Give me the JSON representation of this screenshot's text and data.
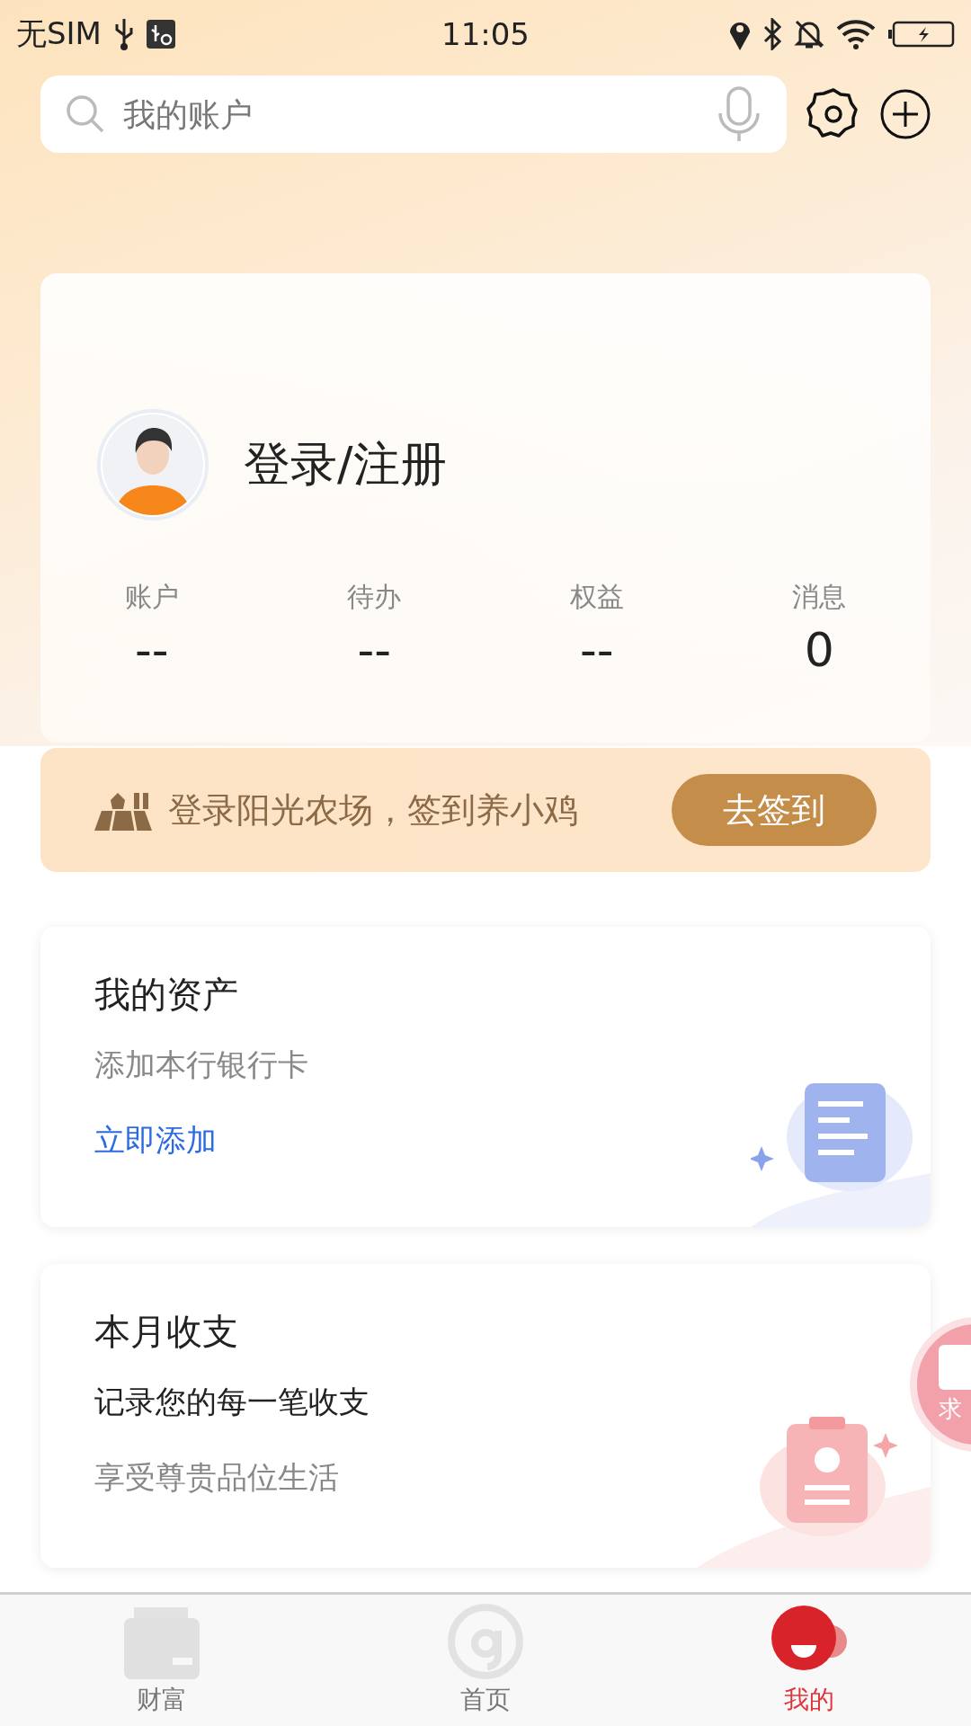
{
  "status_bar": {
    "carrier": "无SIM",
    "time": "11:05"
  },
  "search": {
    "placeholder": "我的账户"
  },
  "profile": {
    "login": "登录/注册",
    "stats": [
      {
        "label": "账户",
        "value": "--"
      },
      {
        "label": "待办",
        "value": "--"
      },
      {
        "label": "权益",
        "value": "--"
      },
      {
        "label": "消息",
        "value": "0"
      }
    ]
  },
  "banner": {
    "text": "登录阳光农场，签到养小鸡",
    "button": "去签到"
  },
  "cards": [
    {
      "kind": "assets",
      "title": "我的资产",
      "lines": [
        {
          "text": "添加本行银行卡",
          "kind": "muted"
        },
        {
          "text": "立即添加",
          "kind": "link"
        }
      ]
    },
    {
      "kind": "budget",
      "title": "本月收支",
      "lines": [
        {
          "text": "记录您的每一笔收支",
          "kind": "dark"
        },
        {
          "text": "享受尊贵品位生活",
          "kind": "muted"
        }
      ]
    }
  ],
  "floating_button": {
    "text": "求"
  },
  "tabs": [
    {
      "label": "财富",
      "kind": "wealth",
      "selected": false
    },
    {
      "label": "首页",
      "kind": "home",
      "selected": false
    },
    {
      "label": "我的",
      "kind": "mine",
      "selected": true
    }
  ]
}
